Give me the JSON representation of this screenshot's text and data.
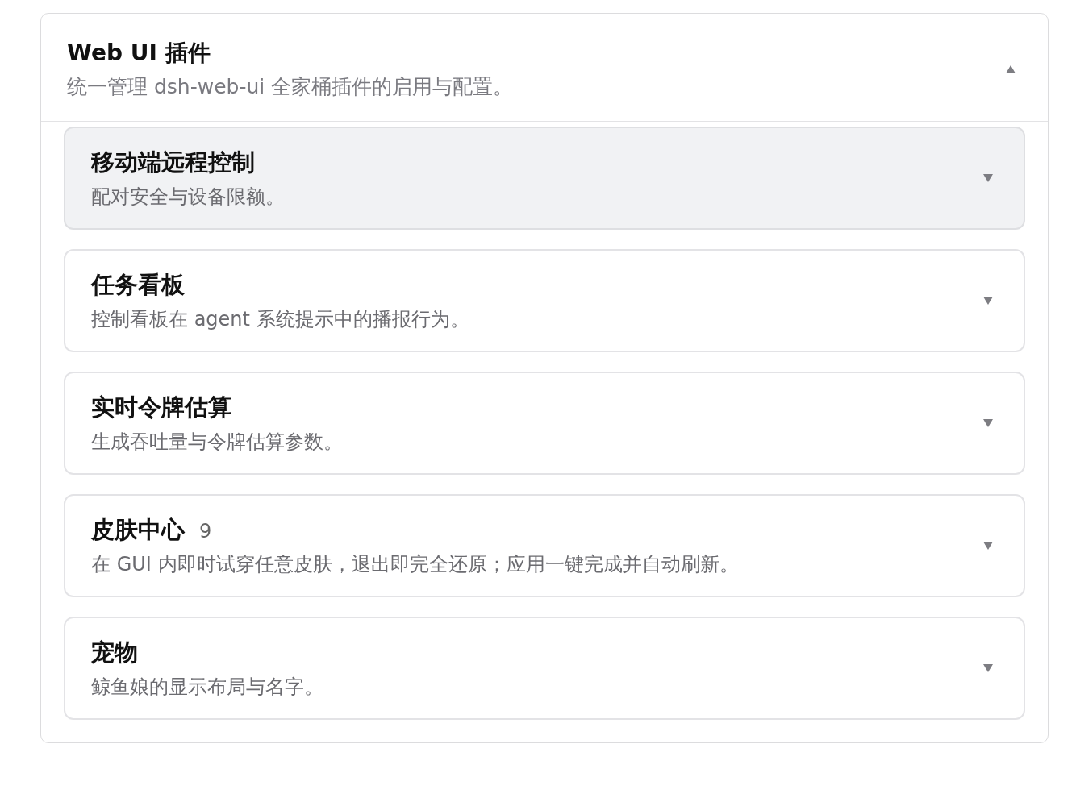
{
  "panel": {
    "title": "Web UI 插件",
    "subtitle": "统一管理 dsh-web-ui 全家桶插件的启用与配置。",
    "expanded": true
  },
  "plugins": [
    {
      "title": "移动端远程控制",
      "description": "配对安全与设备限额。",
      "selected": true,
      "expanded": false
    },
    {
      "title": "任务看板",
      "description": "控制看板在 agent 系统提示中的播报行为。",
      "selected": false,
      "expanded": false
    },
    {
      "title": "实时令牌估算",
      "description": "生成吞吐量与令牌估算参数。",
      "selected": false,
      "expanded": false
    },
    {
      "title": "皮肤中心",
      "count": "9",
      "description": "在 GUI 内即时试穿任意皮肤，退出即完全还原；应用一键完成并自动刷新。",
      "selected": false,
      "expanded": false
    },
    {
      "title": "宠物",
      "description": "鲸鱼娘的显示布局与名字。",
      "selected": false,
      "expanded": false
    }
  ]
}
